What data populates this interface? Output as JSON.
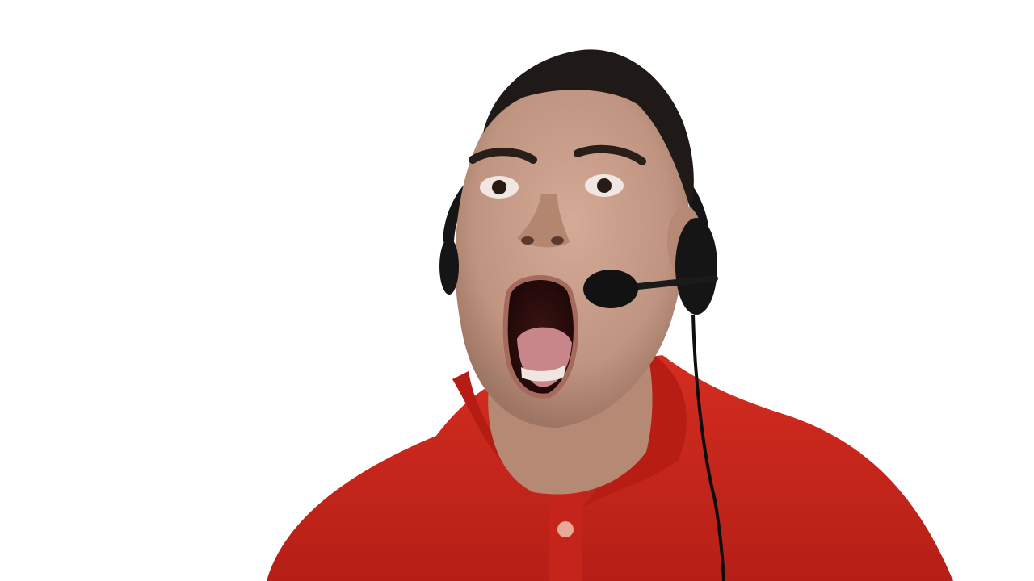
{
  "scene": {
    "background_color": "#ffffff",
    "subject": {
      "shirt_color": "#c8261c",
      "skin_color": "#c9a18c",
      "hair_color": "#1f1a18",
      "headset_color": "#151515"
    }
  }
}
